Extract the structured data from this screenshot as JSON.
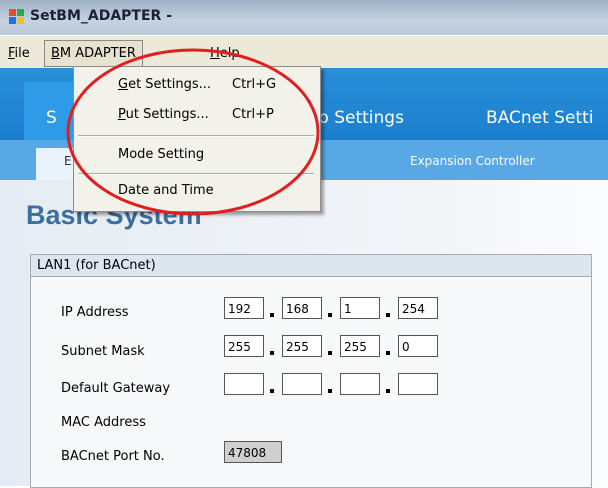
{
  "window": {
    "title": "SetBM_ADAPTER -"
  },
  "menubar": {
    "items": [
      {
        "label": "File",
        "underline": "F",
        "rest": "ile"
      },
      {
        "label": "BM ADAPTER",
        "underline": "B",
        "rest": "M ADAPTER"
      },
      {
        "label": "Help",
        "underline": "H",
        "rest": "elp"
      }
    ]
  },
  "dropdown": {
    "items": [
      {
        "u": "G",
        "rest": "et Settings...",
        "shortcut": "Ctrl+G"
      },
      {
        "u": "P",
        "rest": "ut Settings...",
        "shortcut": "Ctrl+P"
      },
      {
        "label": "Mode Setting"
      },
      {
        "label": "Date and Time"
      }
    ]
  },
  "tabs": {
    "partial_selected": "S",
    "items": [
      "p Settings",
      "BACnet Setti"
    ]
  },
  "subtabs": {
    "partial_selected": "E",
    "items": [
      "Expansion Controller"
    ]
  },
  "main": {
    "heading": "Basic System"
  },
  "lan": {
    "group_title": "LAN1 (for BACnet)",
    "ip_label": "IP Address",
    "ip": [
      "192",
      "168",
      "1",
      "254"
    ],
    "subnet_label": "Subnet Mask",
    "subnet": [
      "255",
      "255",
      "255",
      "0"
    ],
    "gateway_label": "Default Gateway",
    "gateway": [
      "",
      "",
      "",
      ""
    ],
    "mac_label": "MAC Address",
    "port_label": "BACnet Port No.",
    "port": "47808"
  },
  "colors": {
    "tab_blue": "#1b7fcf",
    "heading": "#3a6fa3",
    "annotation": "#e02020"
  }
}
